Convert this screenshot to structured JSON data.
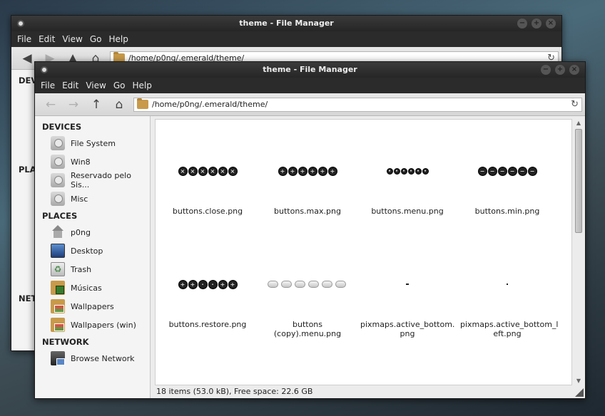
{
  "back_window": {
    "title": "theme - File Manager",
    "menu": [
      "File",
      "Edit",
      "View",
      "Go",
      "Help"
    ],
    "path": "/home/p0ng/.emerald/theme/",
    "sidebar_sections": [
      "DEVI",
      "PLA",
      "NET"
    ]
  },
  "front_window": {
    "title": "theme - File Manager",
    "menu": [
      "File",
      "Edit",
      "View",
      "Go",
      "Help"
    ],
    "path": "/home/p0ng/.emerald/theme/",
    "sidebar": {
      "devices_title": "DEVICES",
      "devices": [
        {
          "label": "File System",
          "icon": "drive-icon"
        },
        {
          "label": "Win8",
          "icon": "drive-icon"
        },
        {
          "label": "Reservado pelo Sis...",
          "icon": "drive-icon"
        },
        {
          "label": "Misc",
          "icon": "drive-icon"
        }
      ],
      "places_title": "PLACES",
      "places": [
        {
          "label": "p0ng",
          "icon": "home-icon"
        },
        {
          "label": "Desktop",
          "icon": "desktop-icon"
        },
        {
          "label": "Trash",
          "icon": "trash-icon"
        },
        {
          "label": "Músicas",
          "icon": "music-folder-icon"
        },
        {
          "label": "Wallpapers",
          "icon": "pictures-folder-icon"
        },
        {
          "label": "Wallpapers (win)",
          "icon": "pictures-folder-icon"
        }
      ],
      "network_title": "NETWORK",
      "network": [
        {
          "label": "Browse Network",
          "icon": "network-icon"
        }
      ]
    },
    "files": [
      {
        "name": "buttons.close.png",
        "thumb": "close"
      },
      {
        "name": "buttons.max.png",
        "thumb": "max"
      },
      {
        "name": "buttons.menu.png",
        "thumb": "menu"
      },
      {
        "name": "buttons.min.png",
        "thumb": "min"
      },
      {
        "name": "buttons.restore.png",
        "thumb": "restore"
      },
      {
        "name": "buttons (copy).menu.png",
        "thumb": "pills"
      },
      {
        "name": "pixmaps.active_bottom.png",
        "thumb": "dash"
      },
      {
        "name": "pixmaps.active_bottom_left.png",
        "thumb": "dot"
      }
    ],
    "file_display_names": [
      "buttons.close.png",
      "buttons.max.png",
      "buttons.menu.png",
      "buttons.min.png",
      "buttons.restore.png",
      "buttons\n(copy).menu.png",
      "pixmaps.active_bottom.\npng",
      "pixmaps.active_bottom_l\neft.png"
    ],
    "status": "18 items (53.0 kB), Free space: 22.6 GB"
  },
  "colors": {
    "titlebar": "#2b2b2b",
    "folder": "#c89a4a",
    "desktop_bg": "#3c4a52"
  }
}
